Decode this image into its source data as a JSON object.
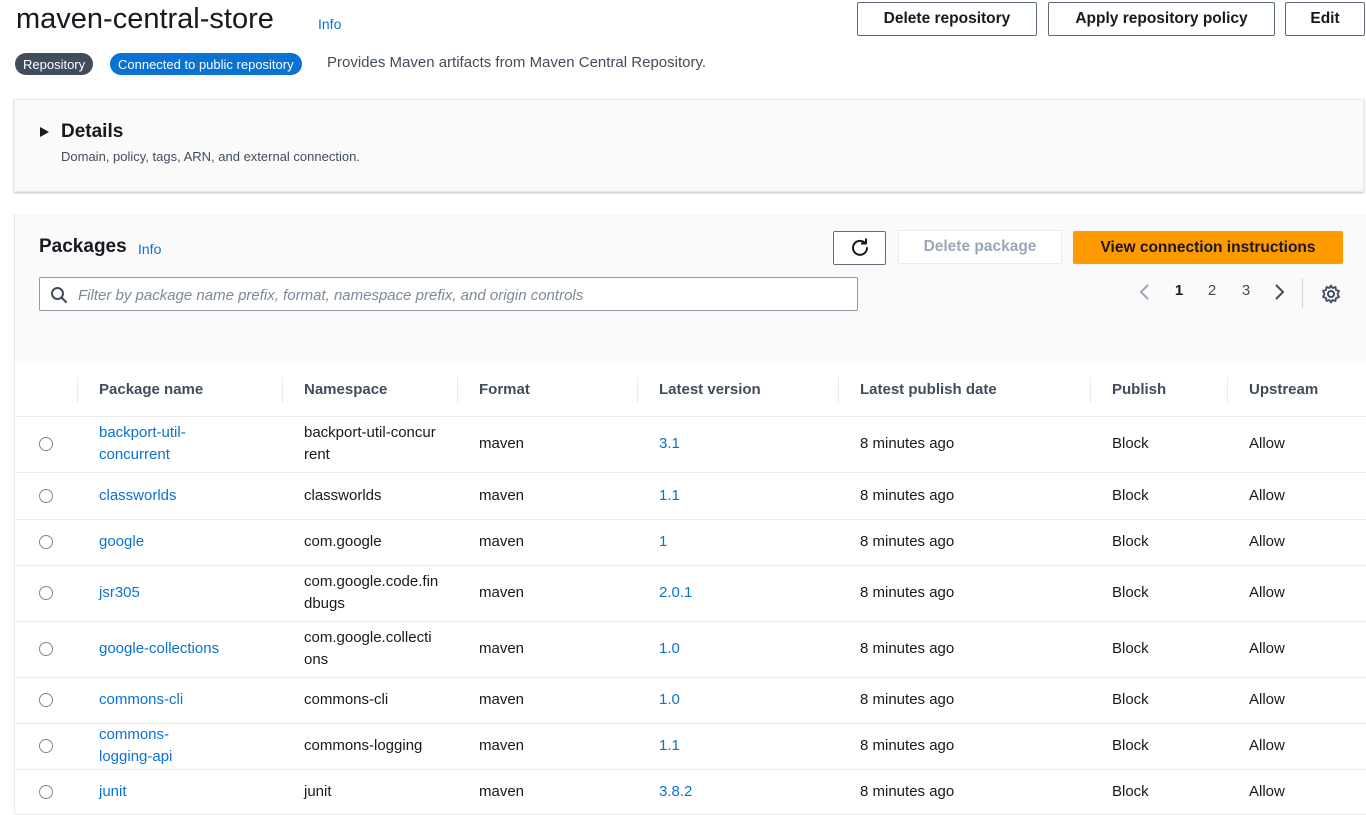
{
  "header": {
    "title": "maven-central-store",
    "info_label": "Info",
    "badges": [
      "Repository",
      "Connected to public repository"
    ],
    "description": "Provides Maven artifacts from Maven Central Repository.",
    "actions": {
      "delete_repository": "Delete repository",
      "apply_policy": "Apply repository policy",
      "edit": "Edit"
    }
  },
  "details": {
    "title": "Details",
    "subtitle": "Domain, policy, tags, ARN, and external connection."
  },
  "packages": {
    "title": "Packages",
    "info_label": "Info",
    "delete_label": "Delete package",
    "view_instructions_label": "View connection instructions",
    "search_placeholder": "Filter by package name prefix, format, namespace prefix, and origin controls",
    "pagination": {
      "pages": [
        "1",
        "2",
        "3"
      ],
      "current": "1"
    },
    "columns": [
      "Package name",
      "Namespace",
      "Format",
      "Latest version",
      "Latest publish date",
      "Publish",
      "Upstream"
    ],
    "rows": [
      {
        "name": "backport-util-concurrent",
        "namespace": "backport-util-concurrent",
        "format": "maven",
        "version": "3.1",
        "date": "8 minutes ago",
        "publish": "Block",
        "upstream": "Allow"
      },
      {
        "name": "classworlds",
        "namespace": "classworlds",
        "format": "maven",
        "version": "1.1",
        "date": "8 minutes ago",
        "publish": "Block",
        "upstream": "Allow"
      },
      {
        "name": "google",
        "namespace": "com.google",
        "format": "maven",
        "version": "1",
        "date": "8 minutes ago",
        "publish": "Block",
        "upstream": "Allow"
      },
      {
        "name": "jsr305",
        "namespace": "com.google.code.findbugs",
        "format": "maven",
        "version": "2.0.1",
        "date": "8 minutes ago",
        "publish": "Block",
        "upstream": "Allow"
      },
      {
        "name": "google-collections",
        "namespace": "com.google.collections",
        "format": "maven",
        "version": "1.0",
        "date": "8 minutes ago",
        "publish": "Block",
        "upstream": "Allow"
      },
      {
        "name": "commons-cli",
        "namespace": "commons-cli",
        "format": "maven",
        "version": "1.0",
        "date": "8 minutes ago",
        "publish": "Block",
        "upstream": "Allow"
      },
      {
        "name": "commons-logging-api",
        "namespace": "commons-logging",
        "format": "maven",
        "version": "1.1",
        "date": "8 minutes ago",
        "publish": "Block",
        "upstream": "Allow"
      },
      {
        "name": "junit",
        "namespace": "junit",
        "format": "maven",
        "version": "3.8.2",
        "date": "8 minutes ago",
        "publish": "Block",
        "upstream": "Allow"
      }
    ]
  },
  "colors": {
    "accent": "#0972d3",
    "primary_button": "#ff9900",
    "badge_gray": "#414d5c"
  }
}
